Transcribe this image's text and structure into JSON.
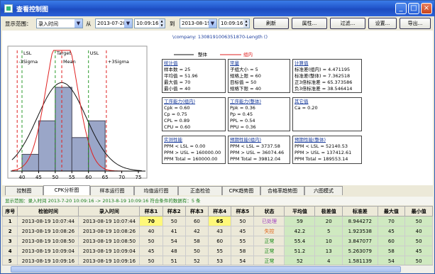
{
  "window": {
    "title": "查看控制图"
  },
  "toolbar": {
    "range_label": "显示范围：",
    "range_value": "录入时间",
    "from_label": "从",
    "from_date": "2013-07-20",
    "from_time": "10:09:16",
    "to_label": "到",
    "to_date": "2013-08-19",
    "to_time": "10:09:16",
    "refresh": "刷新",
    "attributes": "属性...",
    "filter": "过滤...",
    "settings": "设置...",
    "export": "导出..."
  },
  "company_text": "\\company: 1308191006351870-Length  ()",
  "legend": {
    "overall": "整体",
    "within": "组内"
  },
  "histogram": {
    "lines": [
      "LSL",
      "Target",
      "USL",
      "-3Sigma",
      "Mean",
      "+3Sigma"
    ],
    "ticks": [
      "40",
      "45",
      "50",
      "55",
      "60",
      "65",
      "70",
      "75"
    ],
    "bins": [
      1,
      3,
      5,
      2,
      3
    ]
  },
  "stats": {
    "summary": {
      "title": "统计值",
      "lines": [
        "样本数 = 25",
        "平均值 = 51.96",
        "最大值 = 70",
        "最小值 = 40"
      ]
    },
    "constants": {
      "title": "常量",
      "lines": [
        "子组大小 = 5",
        "规格上限 = 60",
        "目标值 = 50",
        "规格下限 = 40"
      ]
    },
    "calc": {
      "title": "计算值",
      "lines": [
        "标准差(组内) = 4.471195",
        "标准差(整体) = 7.362518",
        "正3倍标准差 = 65.373586",
        "负3倍标准差 = 38.546414"
      ]
    },
    "within": {
      "title": "工序能力(组内)",
      "lines": [
        "Cpk = 0.60",
        "Cp = 0.75",
        "CPL = 0.89",
        "CPU = 0.60"
      ]
    },
    "overall": {
      "title": "工序能力(整体)",
      "lines": [
        "Ppk = 0.36",
        "Pp = 0.45",
        "PPL = 0.54",
        "PPU = 0.36"
      ]
    },
    "other": {
      "title": "其它值",
      "lines": [
        "Ca = 0.20"
      ]
    },
    "actual": {
      "title": "实测性能",
      "lines": [
        "PPM < LSL = 0.00",
        "PPM > USL = 160000.00",
        "PPM Total = 160000.00"
      ]
    },
    "pred_within": {
      "title": "预期性能(组内)",
      "lines": [
        "PPM < LSL = 3737.58",
        "PPM > USL = 36074.46",
        "PPM Total = 39812.04"
      ]
    },
    "pred_overall": {
      "title": "预期性能(整体)",
      "lines": [
        "PPM < LSL = 52140.53",
        "PPM > USL = 137412.61",
        "PPM Total = 189553.14"
      ]
    }
  },
  "tabs": [
    "控制图",
    "CPK分析图",
    "样本运行图",
    "均值运行图",
    "正态检验",
    "CPK趋势图",
    "合格率趋势图",
    "六图模式"
  ],
  "info_line": "显示范围：录入时间  2013-7-20 10:09:16 -> 2013-8-19 10:09:16  符合条件的数据有：5 条",
  "table": {
    "headers": [
      "序号",
      "检验时间",
      "录入时间",
      "样本1",
      "样本2",
      "样本3",
      "样本4",
      "样本5",
      "状态",
      "平均值",
      "极差值",
      "标准差",
      "最大值",
      "最小值"
    ],
    "rows": [
      [
        "1",
        "2013-08-19 10:07:44",
        "2013-08-19 10:07:44",
        "70",
        "50",
        "60",
        "65",
        "50",
        "已处理",
        "59",
        "20",
        "8.944272",
        "70",
        "50"
      ],
      [
        "2",
        "2013-08-19 10:08:26",
        "2013-08-19 10:08:26",
        "40",
        "41",
        "42",
        "43",
        "45",
        "失控",
        "42.2",
        "5",
        "1.923538",
        "45",
        "40"
      ],
      [
        "3",
        "2013-08-19 10:08:50",
        "2013-08-19 10:08:50",
        "50",
        "54",
        "58",
        "60",
        "55",
        "正常",
        "55.4",
        "10",
        "3.847077",
        "60",
        "50"
      ],
      [
        "4",
        "2013-08-19 10:09:04",
        "2013-08-19 10:09:04",
        "45",
        "48",
        "50",
        "55",
        "58",
        "正常",
        "51.2",
        "13",
        "5.263079",
        "58",
        "45"
      ],
      [
        "5",
        "2013-08-19 10:09:16",
        "2013-08-19 10:09:16",
        "50",
        "51",
        "52",
        "53",
        "54",
        "正常",
        "52",
        "4",
        "1.581139",
        "54",
        "50"
      ]
    ]
  },
  "colors": {
    "within_curve": "#e02020",
    "overall_curve": "#111111",
    "bars": "#9aa6c8",
    "status_processed": "#a040c0",
    "status_out": "#e06010",
    "status_ok": "#148a14",
    "highlight": "#fff87a"
  }
}
